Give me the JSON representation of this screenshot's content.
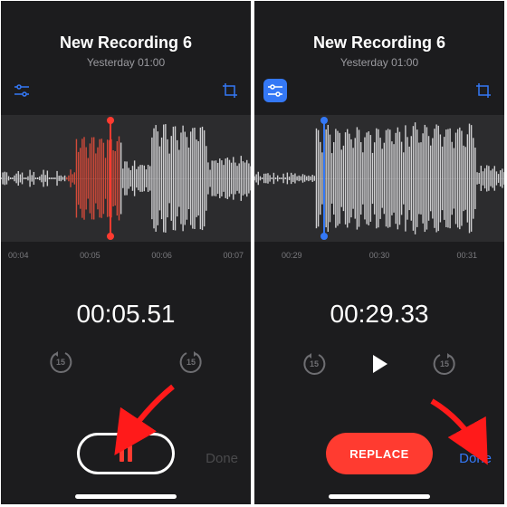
{
  "left": {
    "title": "New Recording 6",
    "subtitle": "Yesterday  01:00",
    "toolbar_accent": "#3478f6",
    "playhead_x_pct": 44,
    "playhead_color": "#ff3b30",
    "ticks": [
      "00:04",
      "00:05",
      "00:06",
      "00:07"
    ],
    "elapsed": "00:05.51",
    "skip_seconds": "15",
    "center_control": "pause",
    "done_label": "Done",
    "done_state": "disabled"
  },
  "right": {
    "title": "New Recording 6",
    "subtitle": "Yesterday  01:00",
    "toolbar_accent": "#3478f6",
    "adjust_active": true,
    "playhead_x_pct": 28,
    "playhead_color": "#3478f6",
    "ticks": [
      "00:29",
      "00:30",
      "00:31"
    ],
    "elapsed": "00:29.33",
    "skip_seconds": "15",
    "center_control": "play",
    "button_label": "REPLACE",
    "done_label": "Done",
    "done_state": "enabled"
  }
}
